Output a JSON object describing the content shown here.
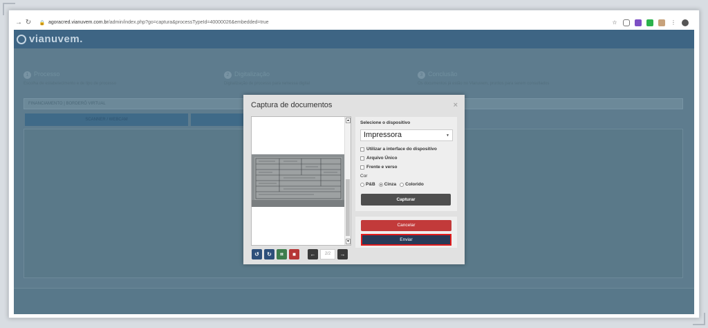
{
  "browser": {
    "url_host": "agoracred.vianuvem.com.br",
    "url_path": "/admin/index.php?go=captura&processTypeId=40000026&embedded=true"
  },
  "app": {
    "logo": "vianuvem."
  },
  "steps": [
    {
      "num": "1",
      "title": "Processo",
      "desc": "Escolha de estabelecimento e de tipo de processo"
    },
    {
      "num": "2",
      "title": "Digitalização",
      "desc": "Digitalização de processo para remessa digital"
    },
    {
      "num": "3",
      "title": "Conclusão",
      "desc": "Os documentos já estão no Vianuvem, prontos para serem consultados"
    }
  ],
  "field_bar": "FINANCIAMENTO | BORDERÔ VIRTUAL",
  "tabs": [
    "SCANNER / WEBCAM"
  ],
  "modal": {
    "title": "Captura de documentos",
    "close": "×",
    "device_label": "Selecione o dispositivo",
    "device_value": "Impressora",
    "options": [
      "Utilizar a interface do dispositivo",
      "Arquivo Único",
      "Frente e verso"
    ],
    "color_label": "Cor",
    "color_options": [
      "P&B",
      "Cinza",
      "Colorido"
    ],
    "color_selected": "Cinza",
    "capture_button": "Capturar",
    "cancel_button": "Cancelar",
    "send_button": "Enviar",
    "pager": "2/2"
  },
  "colors": {
    "header": "#3e6584",
    "cancel": "#c23a3a",
    "send": "#283a57",
    "highlight": "#e21b1b"
  }
}
